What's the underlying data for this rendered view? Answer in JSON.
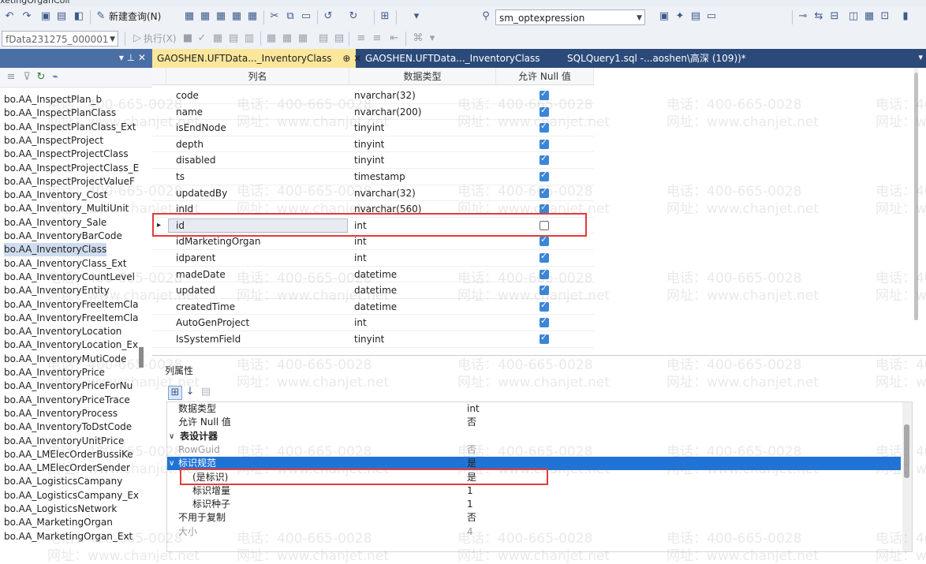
{
  "window": {
    "title_fragment": "xetingOrganColl"
  },
  "toolbar1": {
    "new_query_label": "新建查询(N)",
    "database_dropdown": "sm_optexpression"
  },
  "toolbar2": {
    "db_dropdown": "fData231275_000001",
    "execute_label": "执行(X)"
  },
  "explorer": {
    "pin_glyph": "▾ ⊥ ✕",
    "items": [
      "bo.AA_InspectPlan_b",
      "bo.AA_InspectPlanClass",
      "bo.AA_InspectPlanClass_Ext",
      "bo.AA_InspectProject",
      "bo.AA_InspectProjectClass",
      "bo.AA_InspectProjectClass_E",
      "bo.AA_InspectProjectValueF",
      "bo.AA_Inventory_Cost",
      "bo.AA_Inventory_MultiUnit",
      "bo.AA_Inventory_Sale",
      "bo.AA_InventoryBarCode",
      "bo.AA_InventoryClass",
      "bo.AA_InventoryClass_Ext",
      "bo.AA_InventoryCountLevel",
      "bo.AA_InventoryEntity",
      "bo.AA_InventoryFreeItemCla",
      "bo.AA_InventoryFreeItemCla",
      "bo.AA_InventoryLocation",
      "bo.AA_InventoryLocation_Ex",
      "bo.AA_InventoryMutiCode",
      "bo.AA_InventoryPrice",
      "bo.AA_InventoryPriceForNu",
      "bo.AA_InventoryPriceTrace",
      "bo.AA_InventoryProcess",
      "bo.AA_InventoryToDstCode",
      "bo.AA_InventoryUnitPrice",
      "bo.AA_LMElecOrderBussiKe",
      "bo.AA_LMElecOrderSender",
      "bo.AA_LogisticsCampany",
      "bo.AA_LogisticsCampany_Ex",
      "bo.AA_LogisticsNetwork",
      "bo.AA_MarketingOrgan",
      "bo.AA_MarketingOrgan_Ext"
    ],
    "selected_index": 11
  },
  "tabs": [
    {
      "label": "GAOSHEN.UFTData..._InventoryClass",
      "pin": "⊕ ✕"
    },
    {
      "label": "GAOSHEN.UFTData..._InventoryClass"
    },
    {
      "label": "SQLQuery1.sql -...aoshen\\高深 (109))*"
    }
  ],
  "grid": {
    "headers": {
      "name": "列名",
      "type": "数据类型",
      "null": "允许 Null 值"
    },
    "rows": [
      {
        "name": "code",
        "type": "nvarchar(32)",
        "nullable": true
      },
      {
        "name": "name",
        "type": "nvarchar(200)",
        "nullable": true
      },
      {
        "name": "isEndNode",
        "type": "tinyint",
        "nullable": true
      },
      {
        "name": "depth",
        "type": "tinyint",
        "nullable": true
      },
      {
        "name": "disabled",
        "type": "tinyint",
        "nullable": true
      },
      {
        "name": "ts",
        "type": "timestamp",
        "nullable": true
      },
      {
        "name": "updatedBy",
        "type": "nvarchar(32)",
        "nullable": true
      },
      {
        "name": "inId",
        "type": "nvarchar(560)",
        "nullable": true
      },
      {
        "name": "id",
        "type": "int",
        "nullable": false
      },
      {
        "name": "idMarketingOrgan",
        "type": "int",
        "nullable": true
      },
      {
        "name": "idparent",
        "type": "int",
        "nullable": true
      },
      {
        "name": "madeDate",
        "type": "datetime",
        "nullable": true
      },
      {
        "name": "updated",
        "type": "datetime",
        "nullable": true
      },
      {
        "name": "createdTime",
        "type": "datetime",
        "nullable": true
      },
      {
        "name": "AutoGenProject",
        "type": "int",
        "nullable": true
      },
      {
        "name": "IsSystemField",
        "type": "tinyint",
        "nullable": true
      }
    ],
    "selected_row": 8,
    "row_marker": "▸"
  },
  "props": {
    "title": "列属性",
    "rows": [
      {
        "key": "数据类型",
        "val": "int",
        "indent": 1,
        "style": ""
      },
      {
        "key": "允许 Null 值",
        "val": "否",
        "indent": 1,
        "style": ""
      },
      {
        "key": "表设计器",
        "val": "",
        "indent": 0,
        "style": "bold",
        "expander": "∨"
      },
      {
        "key": "RowGuid",
        "val": "否",
        "indent": 1,
        "style": "gray"
      },
      {
        "key": "标识规范",
        "val": "是",
        "indent": 1,
        "style": "sel",
        "expander": "∨"
      },
      {
        "key": "(是标识)",
        "val": "是",
        "indent": 2,
        "style": ""
      },
      {
        "key": "标识增量",
        "val": "1",
        "indent": 2,
        "style": ""
      },
      {
        "key": "标识种子",
        "val": "1",
        "indent": 2,
        "style": ""
      },
      {
        "key": "不用于复制",
        "val": "否",
        "indent": 1,
        "style": ""
      },
      {
        "key": "大小",
        "val": "4",
        "indent": 1,
        "style": "gray"
      }
    ]
  },
  "watermark": {
    "phone": "电话：400-665-0028",
    "site": "网址：www.chanjet.net"
  },
  "colors": {
    "accent": "#1f73d6",
    "tab_active": "#fbe79b",
    "tab_bar": "#2b4a79",
    "highlight": "#e23b3b"
  }
}
